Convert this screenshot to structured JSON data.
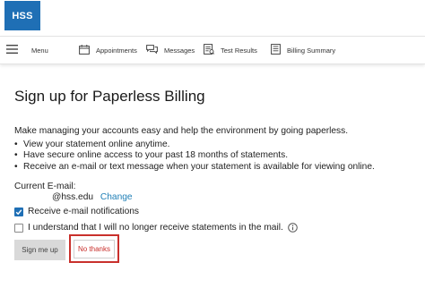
{
  "header": {
    "logo_text": "HSS",
    "brand_color": "#1f6fb5"
  },
  "nav": {
    "menu_label": "Menu",
    "items": [
      {
        "label": "Appointments",
        "icon": "calendar-icon"
      },
      {
        "label": "Messages",
        "icon": "messages-icon"
      },
      {
        "label": "Test Results",
        "icon": "test-results-icon"
      },
      {
        "label": "Billing Summary",
        "icon": "billing-summary-icon"
      }
    ]
  },
  "page": {
    "title": "Sign up for Paperless Billing",
    "intro": "Make managing your accounts easy and help the environment by going paperless.",
    "bullets": [
      "View your statement online anytime.",
      "Have secure online access to your past 18 months of statements.",
      "Receive an e-mail or text message when your statement is available for viewing online."
    ],
    "current_email_label": "Current E-mail:",
    "current_email_value": "@hss.edu",
    "change_link": "Change",
    "email_notifications_label": "Receive e-mail notifications",
    "email_notifications_checked": true,
    "acknowledge_label": "I understand that I will no longer receive statements in the mail.",
    "acknowledge_checked": false
  },
  "buttons": {
    "sign_up": "Sign me up",
    "no_thanks": "No thanks"
  },
  "colors": {
    "link": "#1f7fb6",
    "highlight": "#c9302c"
  }
}
